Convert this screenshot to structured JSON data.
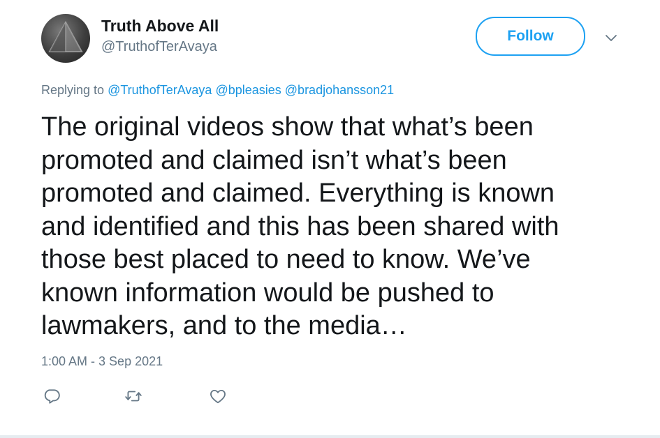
{
  "author": {
    "display_name": "Truth Above All",
    "handle": "@TruthofTerAvaya"
  },
  "follow_button": {
    "label": "Follow",
    "color": "#1da1f2"
  },
  "more_menu_icon": "chevron-down-icon",
  "reply_context": {
    "prefix": "Replying to",
    "mentions": [
      "@TruthofTerAvaya",
      "@bpleasies",
      "@bradjohansson21"
    ],
    "mention_color": "#1b95e0"
  },
  "tweet": {
    "lines": [
      "The original videos show that what’s been",
      "promoted and claimed isn’t what’s been",
      "promoted and claimed. Everything is known",
      "and identified and this has been shared with",
      "those best placed to need to know. We’ve",
      "known information would be pushed to",
      "lawmakers, and to the media…"
    ],
    "timestamp": "1:00 AM - 3 Sep 2021"
  },
  "actions": {
    "icons": [
      "reply-icon",
      "retweet-icon",
      "like-icon"
    ]
  }
}
